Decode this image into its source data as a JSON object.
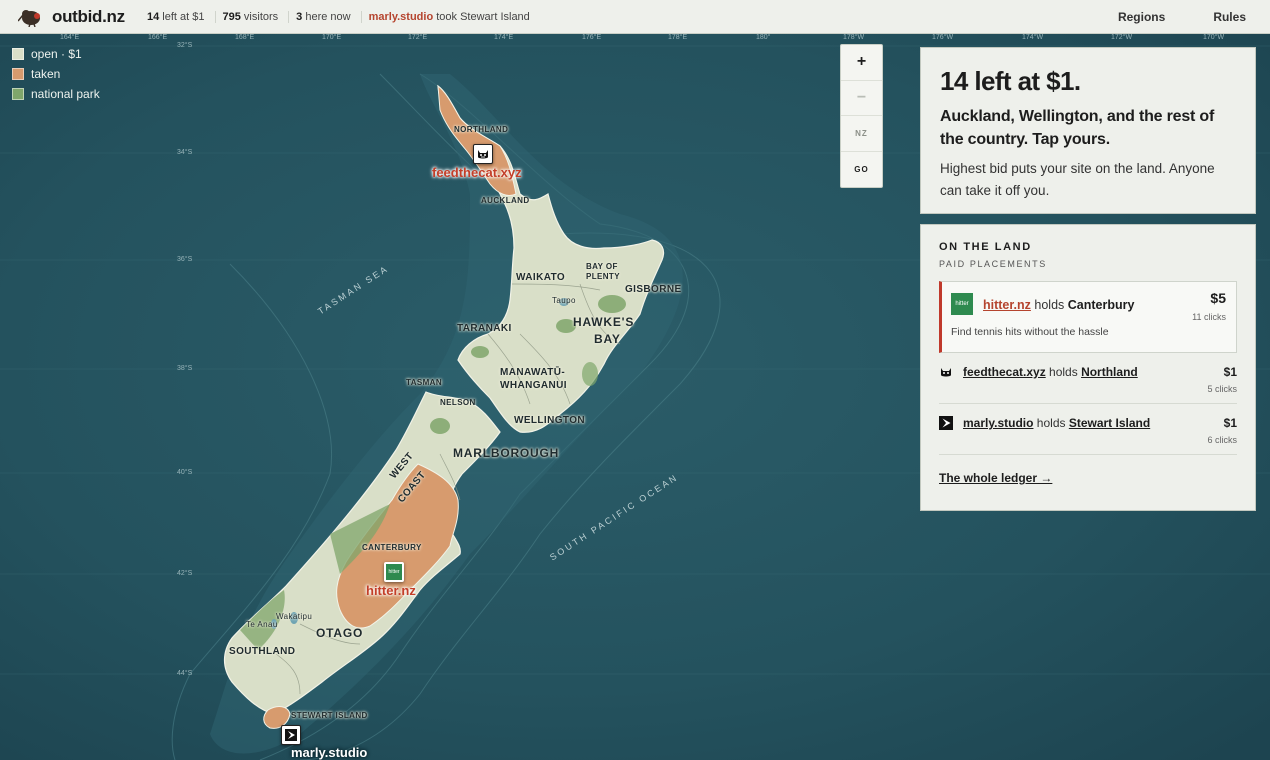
{
  "header": {
    "brand": "outbid.nz",
    "stats": {
      "left_count": "14",
      "left_suffix": " left at $1",
      "visitors_count": "795",
      "visitors_suffix": " visitors",
      "here_count": "3",
      "here_suffix": " here now",
      "recent_site": "marly.studio",
      "recent_action": " took Stewart Island"
    },
    "nav": [
      "Regions",
      "Rules"
    ]
  },
  "legend": [
    {
      "label": "open · $1",
      "color": "#d9dfc8"
    },
    {
      "label": "taken",
      "color": "#d79b6e"
    },
    {
      "label": "national park",
      "color": "#7fa66b"
    }
  ],
  "zoom": {
    "in": "+",
    "out": "−",
    "region": "NZ",
    "go": "GO"
  },
  "map": {
    "longitudes": [
      "164°E",
      "166°E",
      "168°E",
      "170°E",
      "172°E",
      "174°E",
      "176°E",
      "178°E",
      "180°",
      "178°W",
      "176°W",
      "174°W",
      "172°W",
      "170°W"
    ],
    "latitudes": [
      "32°S",
      "34°S",
      "36°S",
      "38°S",
      "40°S",
      "42°S",
      "44°S"
    ],
    "seas": {
      "tasman": "TASMAN SEA",
      "south_pacific": "SOUTH PACIFIC OCEAN"
    },
    "regions": {
      "northland": "NORTHLAND",
      "auckland": "AUCKLAND",
      "waikato": "WAIKATO",
      "bay_of_plenty_1": "BAY OF",
      "bay_of_plenty_2": "PLENTY",
      "gisborne": "GISBORNE",
      "taupo": "Taupo",
      "taranaki": "TARANAKI",
      "hawkes_bay_1": "HAWKE'S",
      "hawkes_bay_2": "BAY",
      "manawatu_1": "MANAWATŪ-",
      "manawatu_2": "WHANGANUI",
      "tasman": "TASMAN",
      "nelson": "NELSON",
      "wellington": "WELLINGTON",
      "marlborough": "MARLBOROUGH",
      "west_coast_1": "WEST",
      "west_coast_2": "COAST",
      "canterbury": "CANTERBURY",
      "te_anau": "Te Anau",
      "wakatipu": "Wakatipu",
      "otago": "OTAGO",
      "southland": "SOUTHLAND",
      "stewart_island": "STEWART ISLAND"
    },
    "placements": {
      "northland": "feedthecat.xyz",
      "canterbury": "hitter.nz",
      "stewart": "marly.studio"
    },
    "hitter_icon_text": "hitter"
  },
  "hero": {
    "title": "14 left at $1.",
    "subtitle": "Auckland, Wellington, and the rest of the country. Tap yours.",
    "text": "Highest bid puts your site on the land. Anyone can take it off you."
  },
  "land": {
    "title": "ON THE LAND",
    "subtitle": "PAID PLACEMENTS",
    "featured": {
      "icon_text": "hitter",
      "site": "hitter.nz",
      "holds": " holds ",
      "region": "Canterbury",
      "price": "$5",
      "clicks": "11 clicks",
      "desc": "Find tennis hits without the hassle"
    },
    "holdings": [
      {
        "site": "feedthecat.xyz",
        "holds": " holds ",
        "region": "Northland",
        "price": "$1",
        "clicks": "5 clicks",
        "icon": "cat-icon"
      },
      {
        "site": "marly.studio",
        "holds": " holds ",
        "region": "Stewart Island",
        "price": "$1",
        "clicks": "6 clicks",
        "icon": "play-icon"
      }
    ],
    "ledger": "The whole ledger →"
  }
}
